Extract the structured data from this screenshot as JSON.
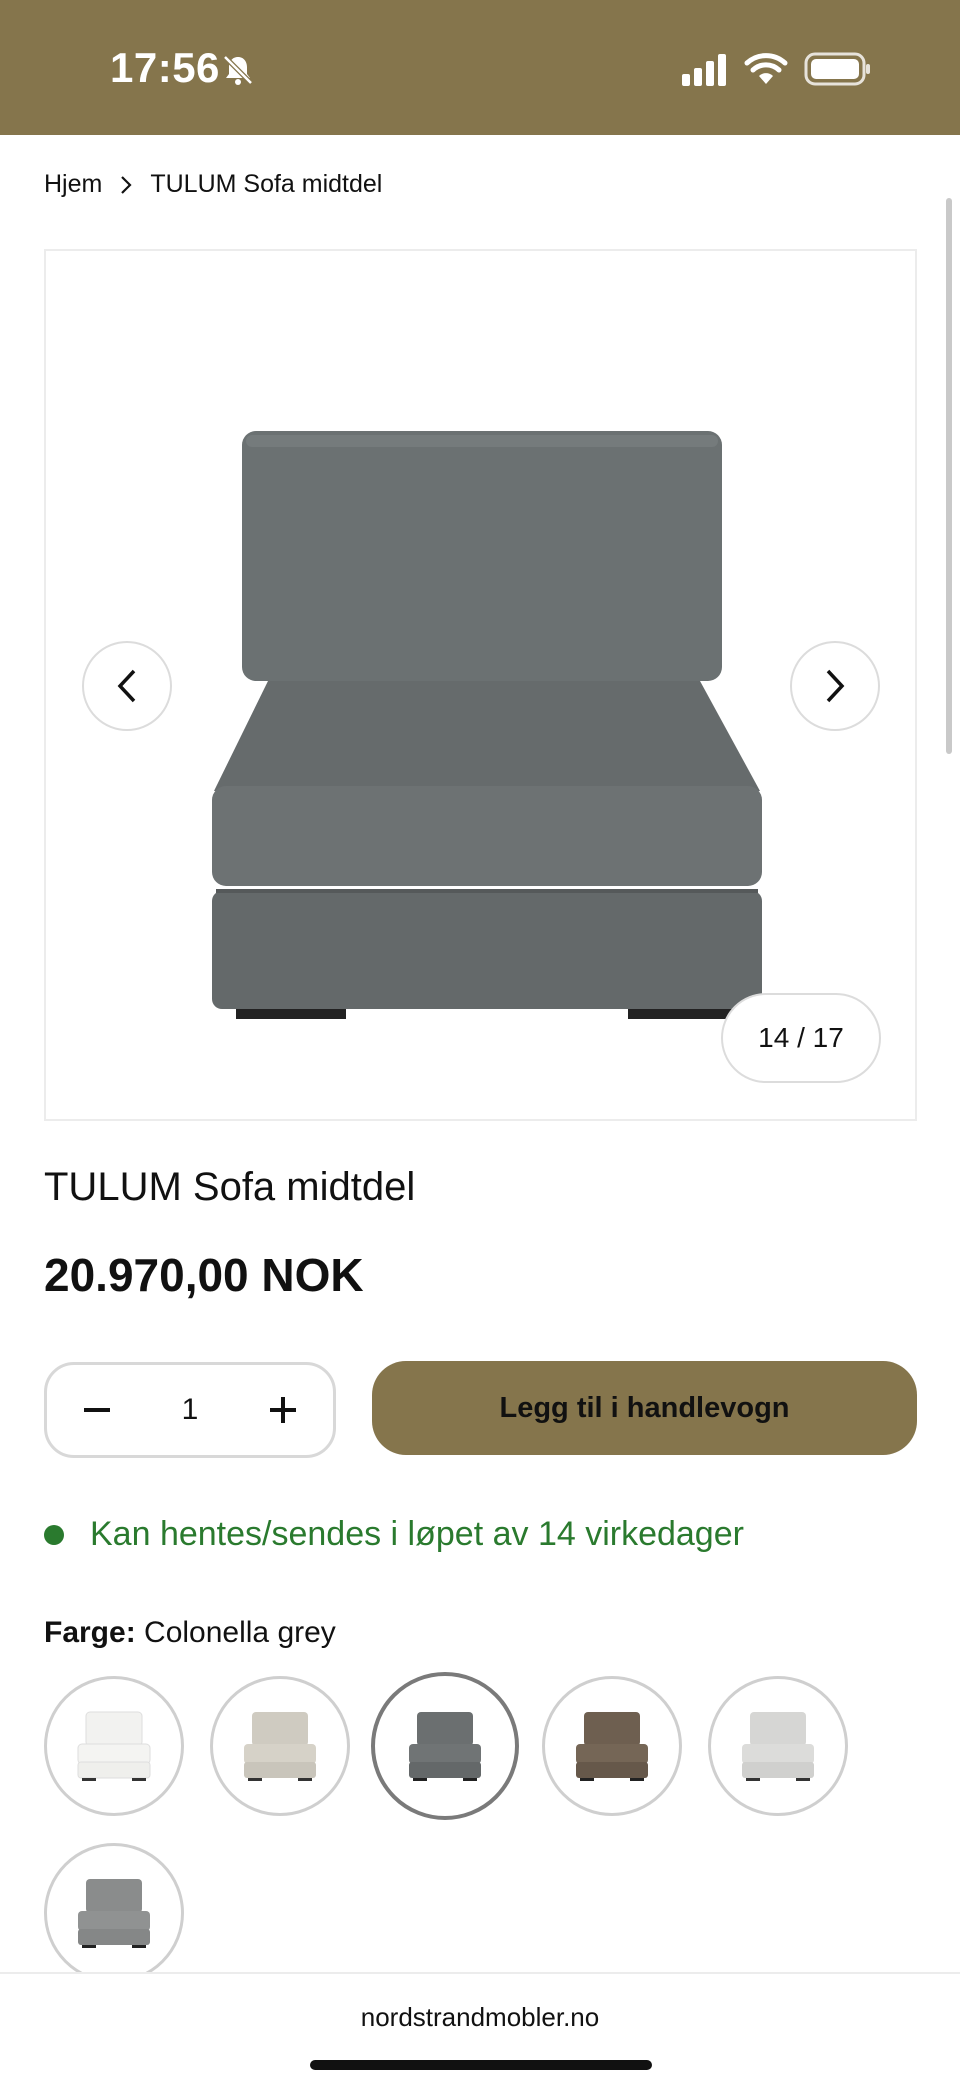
{
  "status_bar": {
    "time": "17:56",
    "icons": [
      "bell-slash-icon",
      "signal-icon",
      "wifi-icon",
      "battery-icon"
    ],
    "background": "#85754c"
  },
  "breadcrumb": {
    "home": "Hjem",
    "current": "TULUM Sofa midtdel"
  },
  "gallery": {
    "counter": "14 / 17",
    "current_index": 14,
    "total": 17
  },
  "product": {
    "title": "TULUM Sofa midtdel",
    "price": "20.970,00 NOK"
  },
  "cart": {
    "quantity": "1",
    "add_label": "Legg til i handlevogn",
    "accent": "#85754c"
  },
  "availability": {
    "text": "Kan hentes/sendes i løpet av 14 virkedager",
    "color": "#2a7a2e"
  },
  "color_option": {
    "label": "Farge:",
    "value": "Colonella grey",
    "swatches": [
      {
        "color": "#f2f2f0"
      },
      {
        "color": "#cfcbc1"
      },
      {
        "color": "#6b6f70",
        "selected": true
      },
      {
        "color": "#6e5f50"
      },
      {
        "color": "#d6d6d4"
      },
      {
        "color": "#8a8c8c"
      }
    ]
  },
  "browser": {
    "url": "nordstrandmobler.no"
  }
}
